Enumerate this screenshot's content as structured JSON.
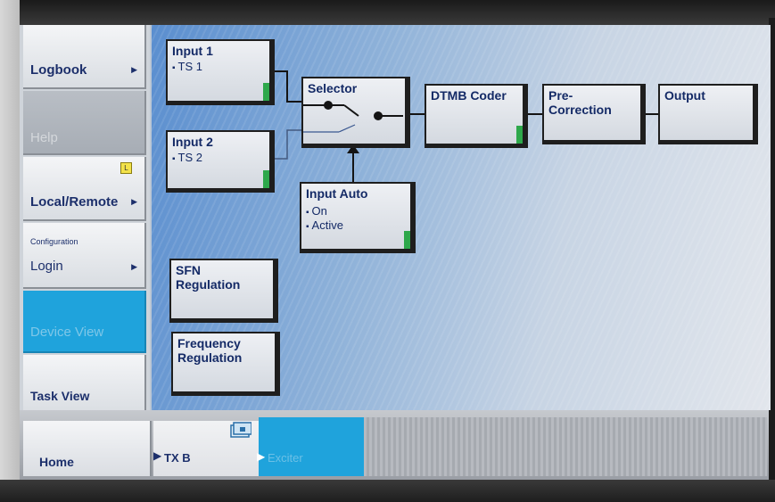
{
  "sidebar": {
    "logbook": "Logbook",
    "help": "Help",
    "local_remote": "Local/Remote",
    "local_badge": "L",
    "configuration_caption": "Configuration",
    "login": "Login",
    "device_view": "Device View",
    "task_view": "Task View",
    "arrow": "▶"
  },
  "diagram": {
    "input1": {
      "title": "Input 1",
      "sub": "TS 1"
    },
    "input2": {
      "title": "Input 2",
      "sub": "TS 2"
    },
    "selector": {
      "title": "Selector"
    },
    "input_auto": {
      "title": "Input Auto",
      "sub1": "On",
      "sub2": "Active"
    },
    "dtmb": {
      "title": "DTMB Coder"
    },
    "precorrection": {
      "title_line1": "Pre-",
      "title_line2": "Correction"
    },
    "output": {
      "title": "Output"
    },
    "sfn": {
      "line1": "SFN",
      "line2": "Regulation"
    },
    "freq": {
      "line1": "Frequency",
      "line2": "Regulation"
    }
  },
  "bottom": {
    "home": "Home",
    "tx": "TX B",
    "exciter": "Exciter"
  },
  "colors": {
    "accent_active": "#1fa3dc",
    "status_led": "#2ea84b",
    "label_text": "#142a66"
  }
}
